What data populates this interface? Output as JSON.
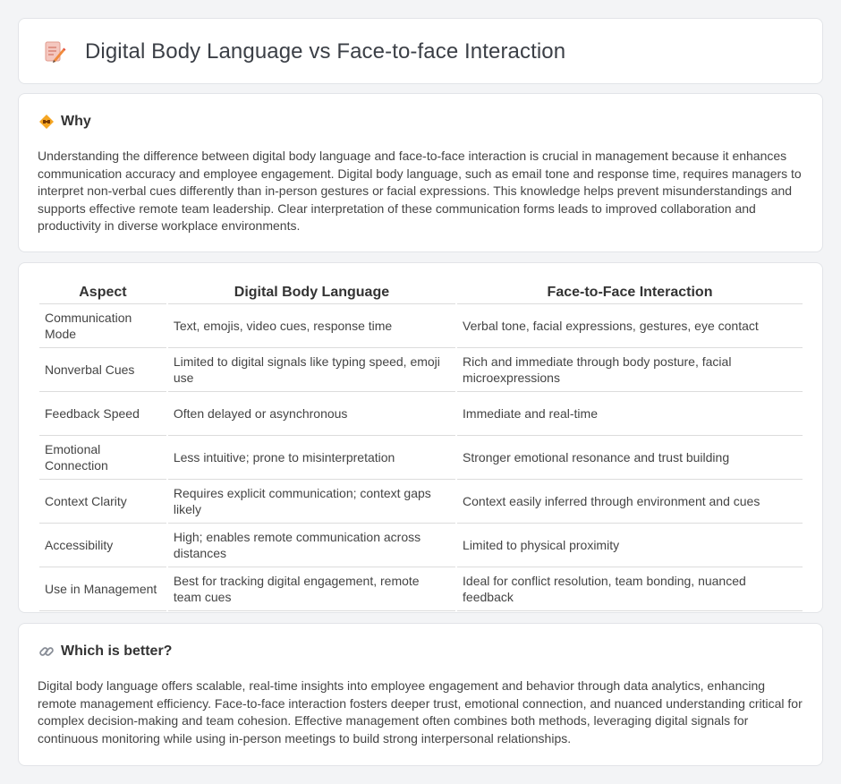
{
  "header": {
    "title": "Digital Body Language vs Face-to-face Interaction",
    "icon": "document-pencil-icon"
  },
  "why": {
    "heading": "Why",
    "icon": "diamond-signpost-icon",
    "text": "Understanding the difference between digital body language and face-to-face interaction is crucial in management because it enhances communication accuracy and employee engagement. Digital body language, such as email tone and response time, requires managers to interpret non-verbal cues differently than in-person gestures or facial expressions. This knowledge helps prevent misunderstandings and supports effective remote team leadership. Clear interpretation of these communication forms leads to improved collaboration and productivity in diverse workplace environments."
  },
  "comparison": {
    "headers": [
      "Aspect",
      "Digital Body Language",
      "Face-to-Face Interaction"
    ],
    "rows": [
      [
        "Communication Mode",
        "Text, emojis, video cues, response time",
        "Verbal tone, facial expressions, gestures, eye contact"
      ],
      [
        "Nonverbal Cues",
        "Limited to digital signals like typing speed, emoji use",
        "Rich and immediate through body posture, facial microexpressions"
      ],
      [
        "Feedback Speed",
        "Often delayed or asynchronous",
        "Immediate and real-time"
      ],
      [
        "Emotional Connection",
        "Less intuitive; prone to misinterpretation",
        "Stronger emotional resonance and trust building"
      ],
      [
        "Context Clarity",
        "Requires explicit communication; context gaps likely",
        "Context easily inferred through environment and cues"
      ],
      [
        "Accessibility",
        "High; enables remote communication across distances",
        "Limited to physical proximity"
      ],
      [
        "Use in Management",
        "Best for tracking digital engagement, remote team cues",
        "Ideal for conflict resolution, team bonding, nuanced feedback"
      ]
    ]
  },
  "better": {
    "heading": "Which is better?",
    "icon": "link-icon",
    "text": "Digital body language offers scalable, real-time insights into employee engagement and behavior through data analytics, enhancing remote management efficiency. Face-to-face interaction fosters deeper trust, emotional connection, and nuanced understanding critical for complex decision-making and team cohesion. Effective management often combines both methods, leveraging digital signals for continuous monitoring while using in-person meetings to build strong interpersonal relationships."
  },
  "colors": {
    "background": "#f3f4f6",
    "card": "#ffffff",
    "border": "#e2e4e8",
    "text": "#444444"
  }
}
